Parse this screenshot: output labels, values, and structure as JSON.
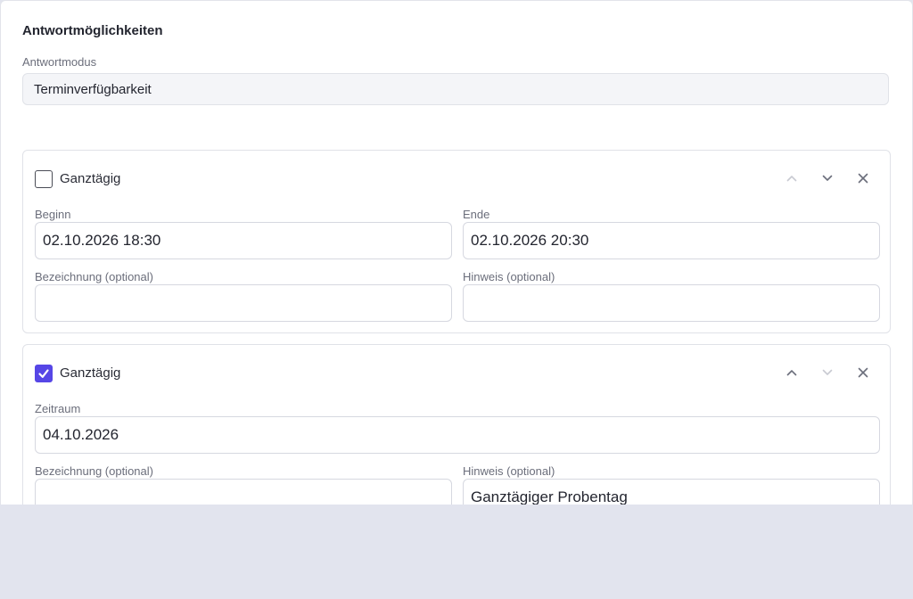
{
  "section_title": "Antwortmöglichkeiten",
  "mode": {
    "label": "Antwortmodus",
    "value": "Terminverfügbarkeit"
  },
  "options": [
    {
      "allday_label": "Ganztägig",
      "allday_checked": false,
      "begin_label": "Beginn",
      "begin_value": "02.10.2026 18:30",
      "end_label": "Ende",
      "end_value": "02.10.2026 20:30",
      "name_label": "Bezeichnung (optional)",
      "name_value": "",
      "note_label": "Hinweis (optional)",
      "note_value": ""
    },
    {
      "allday_label": "Ganztägig",
      "allday_checked": true,
      "period_label": "Zeitraum",
      "period_value": "04.10.2026",
      "name_label": "Bezeichnung (optional)",
      "name_value": "",
      "note_label": "Hinweis (optional)",
      "note_value": "Ganztägiger Probentag"
    }
  ],
  "icons": {
    "move_up": "chevron-up-icon",
    "move_down": "chevron-down-icon",
    "remove": "close-icon",
    "check": "checkmark-icon"
  },
  "colors": {
    "accent": "#5646e6",
    "page_background": "#e2e4ee",
    "card_background": "#ffffff"
  }
}
